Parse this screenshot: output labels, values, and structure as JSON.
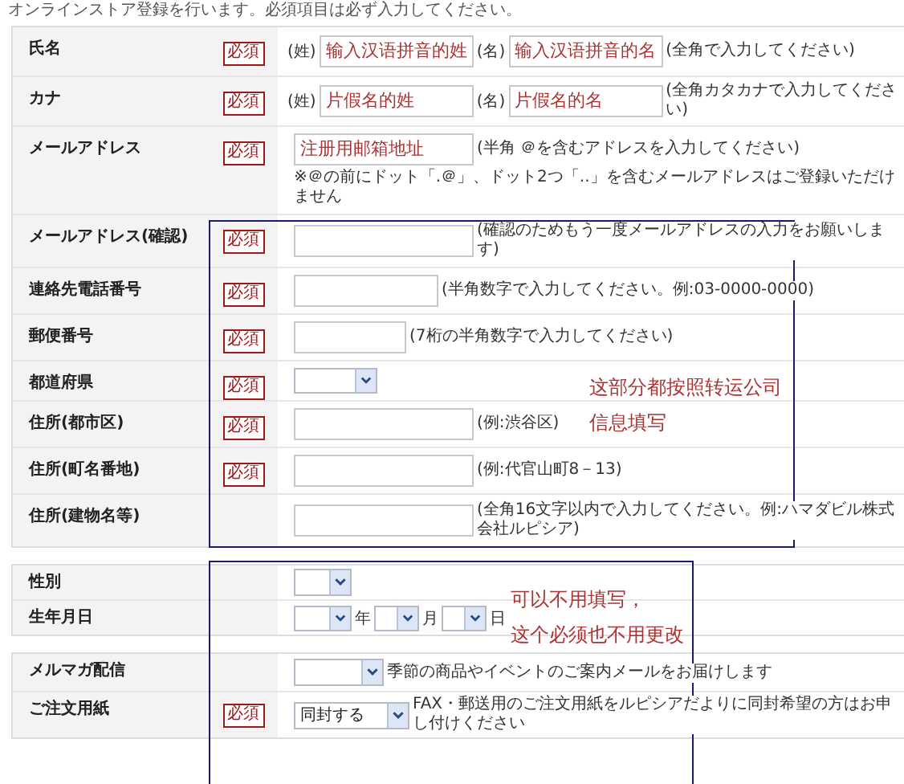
{
  "intro": "オンラインストア登録を行います。必須項目は必ず入力してください。",
  "sections": [
    {
      "rows": [
        {
          "kind": "pair",
          "label": "氏名",
          "badge": "必須",
          "parts": [
            {
              "prefix": "(姓)",
              "value": "输入汉语拼音的姓"
            },
            {
              "prefix": "(名)",
              "value": "输入汉语拼音的名"
            }
          ],
          "note": "(全角で入力してください)"
        },
        {
          "kind": "pair",
          "label": "カナ",
          "badge": "必須",
          "parts": [
            {
              "prefix": "(姓)",
              "value": "片假名的姓"
            },
            {
              "prefix": "(名)",
              "value": "片假名的名"
            }
          ],
          "note": "(全角カタカナで入力してください)"
        },
        {
          "kind": "text",
          "label": "メールアドレス",
          "badge": "必須",
          "value": "注册用邮箱地址",
          "note": "(半角 ＠を含むアドレスを入力してください)",
          "subnote": "※＠の前にドット「.＠」、ドット2つ「..」を含むメールアドレスはご登録いただけません"
        },
        {
          "kind": "text",
          "label": "メールアドレス(確認)",
          "badge": "必須",
          "note": "(確認のためもう一度メールアドレスの入力をお願いします)"
        },
        {
          "kind": "text",
          "label": "連絡先電話番号",
          "badge": "必須",
          "note": "(半角数字で入力してください。例:03-0000-0000)"
        },
        {
          "kind": "text",
          "label": "郵便番号",
          "badge": "必須",
          "note": "(7桁の半角数字で入力してください)"
        },
        {
          "kind": "select",
          "label": "都道府県",
          "badge": "必須"
        },
        {
          "kind": "text",
          "label": "住所(都市区)",
          "badge": "必須",
          "note": "(例:渋谷区)"
        },
        {
          "kind": "text",
          "label": "住所(町名番地)",
          "badge": "必須",
          "note": "(例:代官山町8－13)"
        },
        {
          "kind": "text",
          "label": "住所(建物名等)",
          "note": "(全角16文字以内で入力してください。例:ハマダビル株式会社ルピシア)"
        }
      ]
    },
    {
      "rows": [
        {
          "kind": "select",
          "label": "性別"
        },
        {
          "kind": "date",
          "label": "生年月日",
          "parts": [
            {
              "suffix": "年"
            },
            {
              "suffix": "月"
            },
            {
              "suffix": "日"
            }
          ]
        }
      ]
    },
    {
      "rows": [
        {
          "kind": "select",
          "label": "メルマガ配信",
          "note": "季節の商品やイベントのご案内メールをお届けします"
        },
        {
          "kind": "select",
          "label": "ご注文用紙",
          "badge": "必須",
          "value": "同封する",
          "note": "FAX・郵送用のご注文用紙をルピシアだよりに同封希望の方はお申し付けください"
        }
      ]
    }
  ],
  "annotations": [
    {
      "lines": [
        "这部分都按照转运公司",
        "信息填写"
      ]
    },
    {
      "lines": [
        "可以不用填写，",
        "这个必须也不用更改"
      ]
    }
  ]
}
